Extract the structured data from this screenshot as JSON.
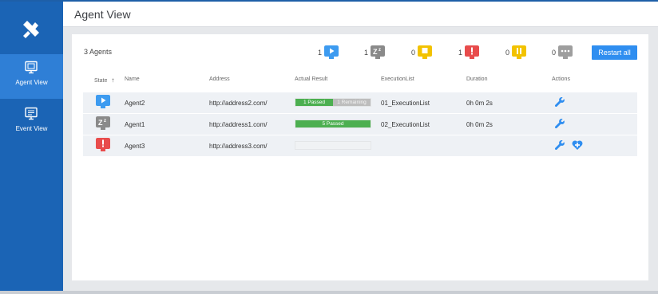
{
  "app": {
    "page_title": "Agent View"
  },
  "sidebar": {
    "items": [
      {
        "label": "Agent View",
        "icon": "monitor-icon",
        "active": true
      },
      {
        "label": "Event View",
        "icon": "event-list-icon",
        "active": false
      }
    ]
  },
  "summary": {
    "agents_count": "3 Agents",
    "stats": [
      {
        "count": "1",
        "state": "running",
        "icon": "play-icon",
        "color": "#3d9bf0"
      },
      {
        "count": "1",
        "state": "sleeping",
        "icon": "sleep-icon",
        "color": "#8a8a8a"
      },
      {
        "count": "0",
        "state": "idle",
        "icon": "stop-icon",
        "color": "#f2c200"
      },
      {
        "count": "1",
        "state": "error",
        "icon": "alert-icon",
        "color": "#e84c4c"
      },
      {
        "count": "0",
        "state": "paused",
        "icon": "pause-icon",
        "color": "#f2c200"
      },
      {
        "count": "0",
        "state": "other",
        "icon": "more-icon",
        "color": "#9e9e9e"
      }
    ],
    "restart_label": "Restart all"
  },
  "table": {
    "headers": {
      "state": "State",
      "name": "Name",
      "address": "Address",
      "result": "Actual Result",
      "execlist": "ExecutionList",
      "duration": "Duration",
      "actions": "Actions"
    },
    "sort_indicator": "↑",
    "rows": [
      {
        "state": "running",
        "state_icon": "play-icon",
        "state_color": "#3d9bf0",
        "name": "Agent2",
        "address": "http://address2.com/",
        "passed_label": "1 Passed",
        "remaining_label": "1 Remaining",
        "passed_fraction": 0.5,
        "execlist": "01_ExecutionList",
        "duration": "0h 0m 2s",
        "actions": [
          "wrench-icon"
        ]
      },
      {
        "state": "sleeping",
        "state_icon": "sleep-icon",
        "state_color": "#8a8a8a",
        "name": "Agent1",
        "address": "http://address1.com/",
        "passed_label": "5 Passed",
        "remaining_label": "",
        "passed_fraction": 1,
        "execlist": "02_ExecutionList",
        "duration": "0h 0m 2s",
        "actions": [
          "wrench-icon"
        ]
      },
      {
        "state": "error",
        "state_icon": "alert-icon",
        "state_color": "#e84c4c",
        "name": "Agent3",
        "address": "http://address3.com/",
        "passed_label": "",
        "remaining_label": "",
        "passed_fraction": 0,
        "execlist": "",
        "duration": "",
        "actions": [
          "wrench-icon",
          "heart-plus-icon"
        ]
      }
    ]
  },
  "colors": {
    "sidebar": "#1b64b5",
    "sidebar_active": "#2f7fd6",
    "accent": "#2f8ef0",
    "pass": "#4caf50"
  }
}
